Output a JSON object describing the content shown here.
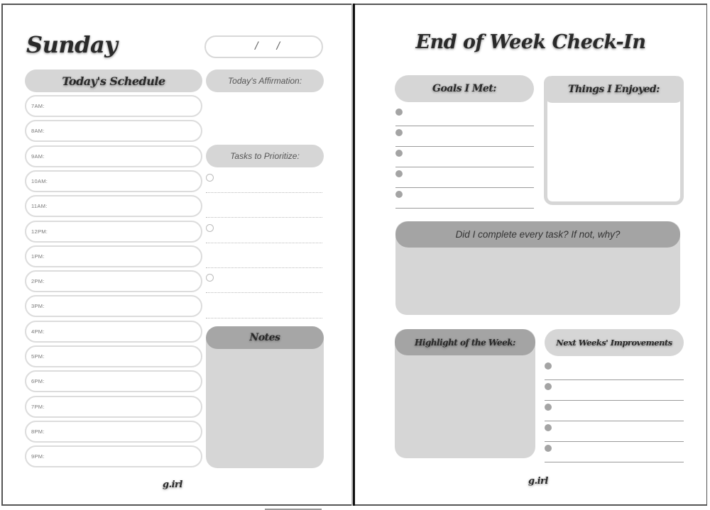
{
  "left_page": {
    "day_title": "Sunday",
    "date_field": {
      "separators": [
        "/",
        "/"
      ],
      "value": ""
    },
    "schedule_header": "Today's Schedule",
    "time_slots": [
      "7AM:",
      "8AM:",
      "9AM:",
      "10AM:",
      "11AM:",
      "12PM:",
      "1PM:",
      "2PM:",
      "3PM:",
      "4PM:",
      "5PM:",
      "6PM:",
      "7PM:",
      "8PM:",
      "9PM:"
    ],
    "affirmation_label": "Today's Affirmation:",
    "tasks_label": "Tasks to Prioritize:",
    "tasks": [
      {
        "has_checkbox": true,
        "text": ""
      },
      {
        "has_checkbox": false,
        "text": ""
      },
      {
        "has_checkbox": true,
        "text": ""
      },
      {
        "has_checkbox": false,
        "text": ""
      },
      {
        "has_checkbox": true,
        "text": ""
      },
      {
        "has_checkbox": false,
        "text": ""
      }
    ],
    "notes_label": "Notes",
    "brand": "g.irl"
  },
  "right_page": {
    "title": "End of Week Check-In",
    "goals_label": "Goals I Met:",
    "goals": [
      "",
      "",
      "",
      "",
      ""
    ],
    "enjoyed_label": "Things I Enjoyed:",
    "task_question": "Did I complete every task? If not, why?",
    "highlight_label": "Highlight of the Week:",
    "improvements_label": "Next Weeks' Improvements",
    "improvements": [
      "",
      "",
      "",
      "",
      ""
    ],
    "brand": "g.irl"
  },
  "colors": {
    "light_gray": "#d6d6d6",
    "mid_gray": "#a4a4a4",
    "text_dark": "#2a2a2a",
    "border": "#555555"
  }
}
